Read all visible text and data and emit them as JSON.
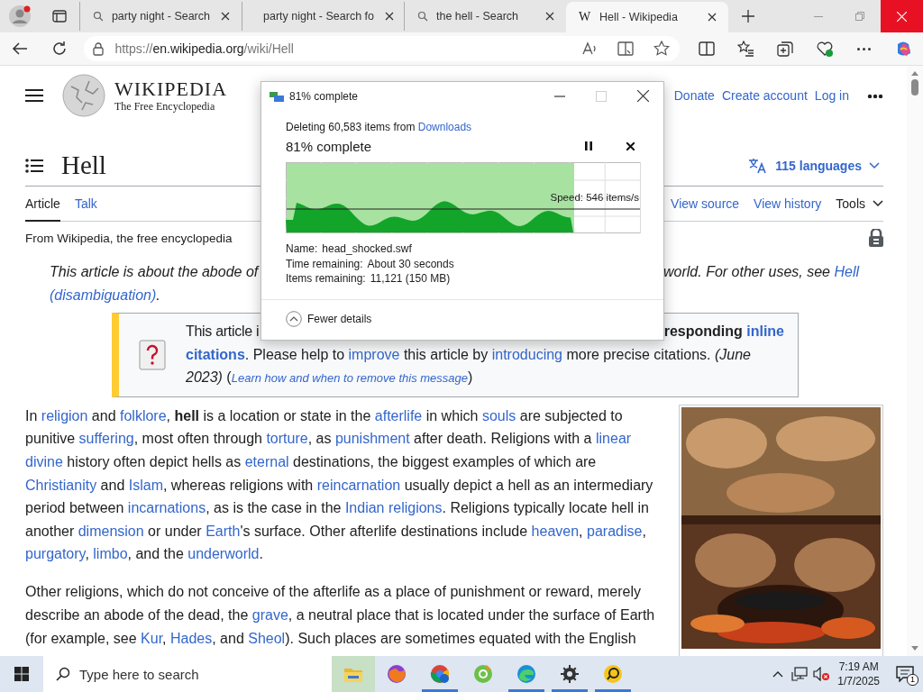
{
  "browser": {
    "tabs": [
      {
        "kind": "search",
        "title": "party night - Search",
        "selected": false
      },
      {
        "kind": "search",
        "title": "party night - Search fo",
        "selected": false
      },
      {
        "kind": "search",
        "title": "the hell - Search",
        "selected": false
      },
      {
        "kind": "page",
        "favicon": "W",
        "title": "Hell - Wikipedia",
        "selected": true
      }
    ],
    "address": {
      "scheme": "https://",
      "host": "en.wikipedia.org",
      "path": "/wiki/Hell"
    }
  },
  "wiki": {
    "wordmark": "WIKIPEDIA",
    "tagline": "The Free Encyclopedia",
    "user_links": [
      "Donate",
      "Create account",
      "Log in"
    ],
    "title": "Hell",
    "languages": "115 languages",
    "tabs": [
      {
        "label": "Article",
        "selected": true
      },
      {
        "label": "Talk",
        "selected": false
      }
    ],
    "actions": [
      "View source",
      "View history"
    ],
    "tools": "Tools",
    "site_note": "From Wikipedia, the free encyclopedia",
    "hatnote": {
      "left": "This article is about the abode of",
      "right": [
        {
          "kind": "text",
          "text": "world. For other uses, see "
        },
        {
          "kind": "link",
          "text": "Hell"
        }
      ],
      "second_line": [
        {
          "kind": "link",
          "text": "(disambiguation)"
        },
        {
          "kind": "text",
          "text": "."
        }
      ]
    },
    "banner": {
      "left": "This article i",
      "right": [
        {
          "kind": "bold",
          "text": "responding"
        },
        {
          "kind": "bold-link",
          "text": "inline",
          "space_before": true
        }
      ],
      "rest": [
        {
          "kind": "bold-link",
          "text": "citations"
        },
        {
          "kind": "text",
          "text": ". Please help to "
        },
        {
          "kind": "link",
          "text": "improve"
        },
        {
          "kind": "text",
          "text": " this article by "
        },
        {
          "kind": "link",
          "text": "introducing"
        },
        {
          "kind": "text",
          "text": " more precise citations. "
        },
        {
          "kind": "italic",
          "text": "(June 2023)"
        },
        {
          "kind": "text",
          "text": " ("
        },
        {
          "kind": "small-link",
          "text": "Learn how and when to remove this message"
        },
        {
          "kind": "text",
          "text": ")"
        }
      ]
    },
    "paragraphs": [
      [
        {
          "kind": "text",
          "text": "In "
        },
        {
          "kind": "link",
          "text": "religion"
        },
        {
          "kind": "text",
          "text": " and "
        },
        {
          "kind": "link",
          "text": "folklore"
        },
        {
          "kind": "text",
          "text": ", "
        },
        {
          "kind": "bold",
          "text": "hell"
        },
        {
          "kind": "text",
          "text": " is a location or state in the "
        },
        {
          "kind": "link",
          "text": "afterlife"
        },
        {
          "kind": "text",
          "text": " in which "
        },
        {
          "kind": "link",
          "text": "souls"
        },
        {
          "kind": "text",
          "text": " are subjected to punitive "
        },
        {
          "kind": "link",
          "text": "suffering"
        },
        {
          "kind": "text",
          "text": ", most often through "
        },
        {
          "kind": "link",
          "text": "torture"
        },
        {
          "kind": "text",
          "text": ", as "
        },
        {
          "kind": "link",
          "text": "punishment"
        },
        {
          "kind": "text",
          "text": " after death. Religions with a "
        },
        {
          "kind": "link",
          "text": "linear"
        },
        {
          "kind": "link",
          "text": "divine",
          "space_before": true
        },
        {
          "kind": "text",
          "text": " history often depict hells as "
        },
        {
          "kind": "link",
          "text": "eternal"
        },
        {
          "kind": "text",
          "text": " destinations, the biggest examples of which are "
        },
        {
          "kind": "link",
          "text": "Christianity"
        },
        {
          "kind": "text",
          "text": " and "
        },
        {
          "kind": "link",
          "text": "Islam"
        },
        {
          "kind": "text",
          "text": ", whereas religions with "
        },
        {
          "kind": "link",
          "text": "reincarnation"
        },
        {
          "kind": "text",
          "text": " usually depict a hell as an intermediary period between "
        },
        {
          "kind": "link",
          "text": "incarnations"
        },
        {
          "kind": "text",
          "text": ", as is the case in the "
        },
        {
          "kind": "link",
          "text": "Indian religions"
        },
        {
          "kind": "text",
          "text": ". Religions typically locate hell in another "
        },
        {
          "kind": "link",
          "text": "dimension"
        },
        {
          "kind": "text",
          "text": " or under "
        },
        {
          "kind": "link",
          "text": "Earth"
        },
        {
          "kind": "text",
          "text": "'s surface. Other afterlife destinations include "
        },
        {
          "kind": "link",
          "text": "heaven"
        },
        {
          "kind": "text",
          "text": ", "
        },
        {
          "kind": "link",
          "text": "paradise"
        },
        {
          "kind": "text",
          "text": ", "
        },
        {
          "kind": "link",
          "text": "purgatory"
        },
        {
          "kind": "text",
          "text": ", "
        },
        {
          "kind": "link",
          "text": "limbo"
        },
        {
          "kind": "text",
          "text": ", and the "
        },
        {
          "kind": "link",
          "text": "underworld"
        },
        {
          "kind": "text",
          "text": "."
        }
      ],
      [
        {
          "kind": "text",
          "text": "Other religions, which do not conceive of the afterlife as a place of punishment or reward, merely describe an abode of the dead, the "
        },
        {
          "kind": "link",
          "text": "grave"
        },
        {
          "kind": "text",
          "text": ", a neutral place that is located under the surface of Earth (for example, see "
        },
        {
          "kind": "link",
          "text": "Kur"
        },
        {
          "kind": "text",
          "text": ", "
        },
        {
          "kind": "link",
          "text": "Hades"
        },
        {
          "kind": "text",
          "text": ", and "
        },
        {
          "kind": "link",
          "text": "Sheol"
        },
        {
          "kind": "text",
          "text": "). Such places are sometimes equated with the English"
        }
      ]
    ]
  },
  "dialog": {
    "title": "81% complete",
    "buttons": [
      {
        "kind": "minimize",
        "disabled": false
      },
      {
        "kind": "maximize",
        "disabled": true
      },
      {
        "kind": "close",
        "disabled": false
      }
    ],
    "message": [
      {
        "kind": "text",
        "text": "Deleting 60,583 items from "
      },
      {
        "kind": "link",
        "text": "Downloads"
      }
    ],
    "heading": "81% complete",
    "level": 0.81,
    "speed": "Speed: 546 items/s",
    "details": [
      {
        "label": "Name:",
        "value": "head_shocked.swf"
      },
      {
        "label": "Time remaining:",
        "value": "About 30 seconds"
      },
      {
        "label": "Items remaining:",
        "value": "11,121 (150 MB)"
      }
    ],
    "toggle": "Fewer details"
  },
  "taskbar": {
    "search_placeholder": "Type here to search",
    "apps": [
      {
        "kind": "folder",
        "running": false,
        "selected": true
      },
      {
        "kind": "ring",
        "running": false,
        "selected": false
      },
      {
        "kind": "wheel",
        "running": true,
        "selected": false
      },
      {
        "kind": "leaf",
        "running": false,
        "selected": false
      },
      {
        "kind": "wave",
        "running": true,
        "selected": false
      },
      {
        "kind": "gear",
        "running": true,
        "selected": false
      },
      {
        "kind": "chat",
        "running": true,
        "selected": false
      }
    ],
    "time": "7:19 AM",
    "date": "1/7/2025",
    "notifications": "1"
  }
}
